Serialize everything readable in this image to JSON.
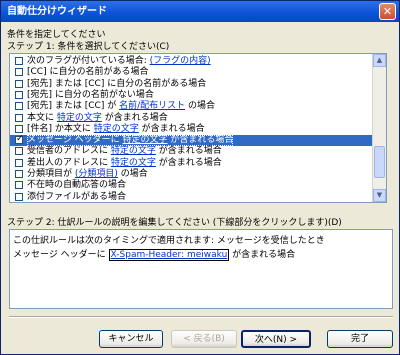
{
  "window": {
    "title": "自動仕分けウィザード",
    "close_glyph": "✕"
  },
  "labels": {
    "instruction": "条件を指定してください",
    "step1": "ステップ 1: 条件を選択してください(C)",
    "step2": "ステップ 2: 仕訳ルールの説明を編集してください (下線部分をクリックします)(D)"
  },
  "conditions": [
    {
      "checked": false,
      "selected": false,
      "before": "次のフラグが付いている場合: ",
      "link": "(フラグの内容)",
      "after": ""
    },
    {
      "checked": false,
      "selected": false,
      "before": "[CC] に自分の名前がある場合",
      "link": "",
      "after": ""
    },
    {
      "checked": false,
      "selected": false,
      "before": "[宛先] または [CC] に自分の名前がある場合",
      "link": "",
      "after": ""
    },
    {
      "checked": false,
      "selected": false,
      "before": "[宛先] に自分の名前がない場合",
      "link": "",
      "after": ""
    },
    {
      "checked": false,
      "selected": false,
      "before": "[宛先] または [CC] が ",
      "link": "名前/配布リスト",
      "after": " の場合"
    },
    {
      "checked": false,
      "selected": false,
      "before": "本文に ",
      "link": "特定の文字",
      "after": " が含まれる場合"
    },
    {
      "checked": false,
      "selected": false,
      "before": "[件名] か本文に ",
      "link": "特定の文字",
      "after": " が含まれる場合"
    },
    {
      "checked": true,
      "selected": true,
      "before": "メッセージ ヘッダーに ",
      "link": "特定の文字",
      "after": " が含まれる場合"
    },
    {
      "checked": false,
      "selected": false,
      "before": "受信者のアドレスに ",
      "link": "特定の文字",
      "after": " が含まれる場合"
    },
    {
      "checked": false,
      "selected": false,
      "before": "差出人のアドレスに ",
      "link": "特定の文字",
      "after": " が含まれる場合"
    },
    {
      "checked": false,
      "selected": false,
      "before": "分類項目が ",
      "link": "(分類項目)",
      "after": " の場合"
    },
    {
      "checked": false,
      "selected": false,
      "before": "不在時の自動応答の場合",
      "link": "",
      "after": ""
    },
    {
      "checked": false,
      "selected": false,
      "before": "添付ファイルがある場合",
      "link": "",
      "after": ""
    }
  ],
  "description": {
    "line1": "この仕訳ルールは次のタイミングで適用されます: メッセージを受信したとき",
    "line2_before": "メッセージ ヘッダーに ",
    "line2_link": "X-Spam-Header: meiwaku",
    "line2_after": " が含まれる場合"
  },
  "buttons": {
    "cancel": "キャンセル",
    "back": "< 戻る(B)",
    "next": "次へ(N) >",
    "finish": "完了"
  }
}
